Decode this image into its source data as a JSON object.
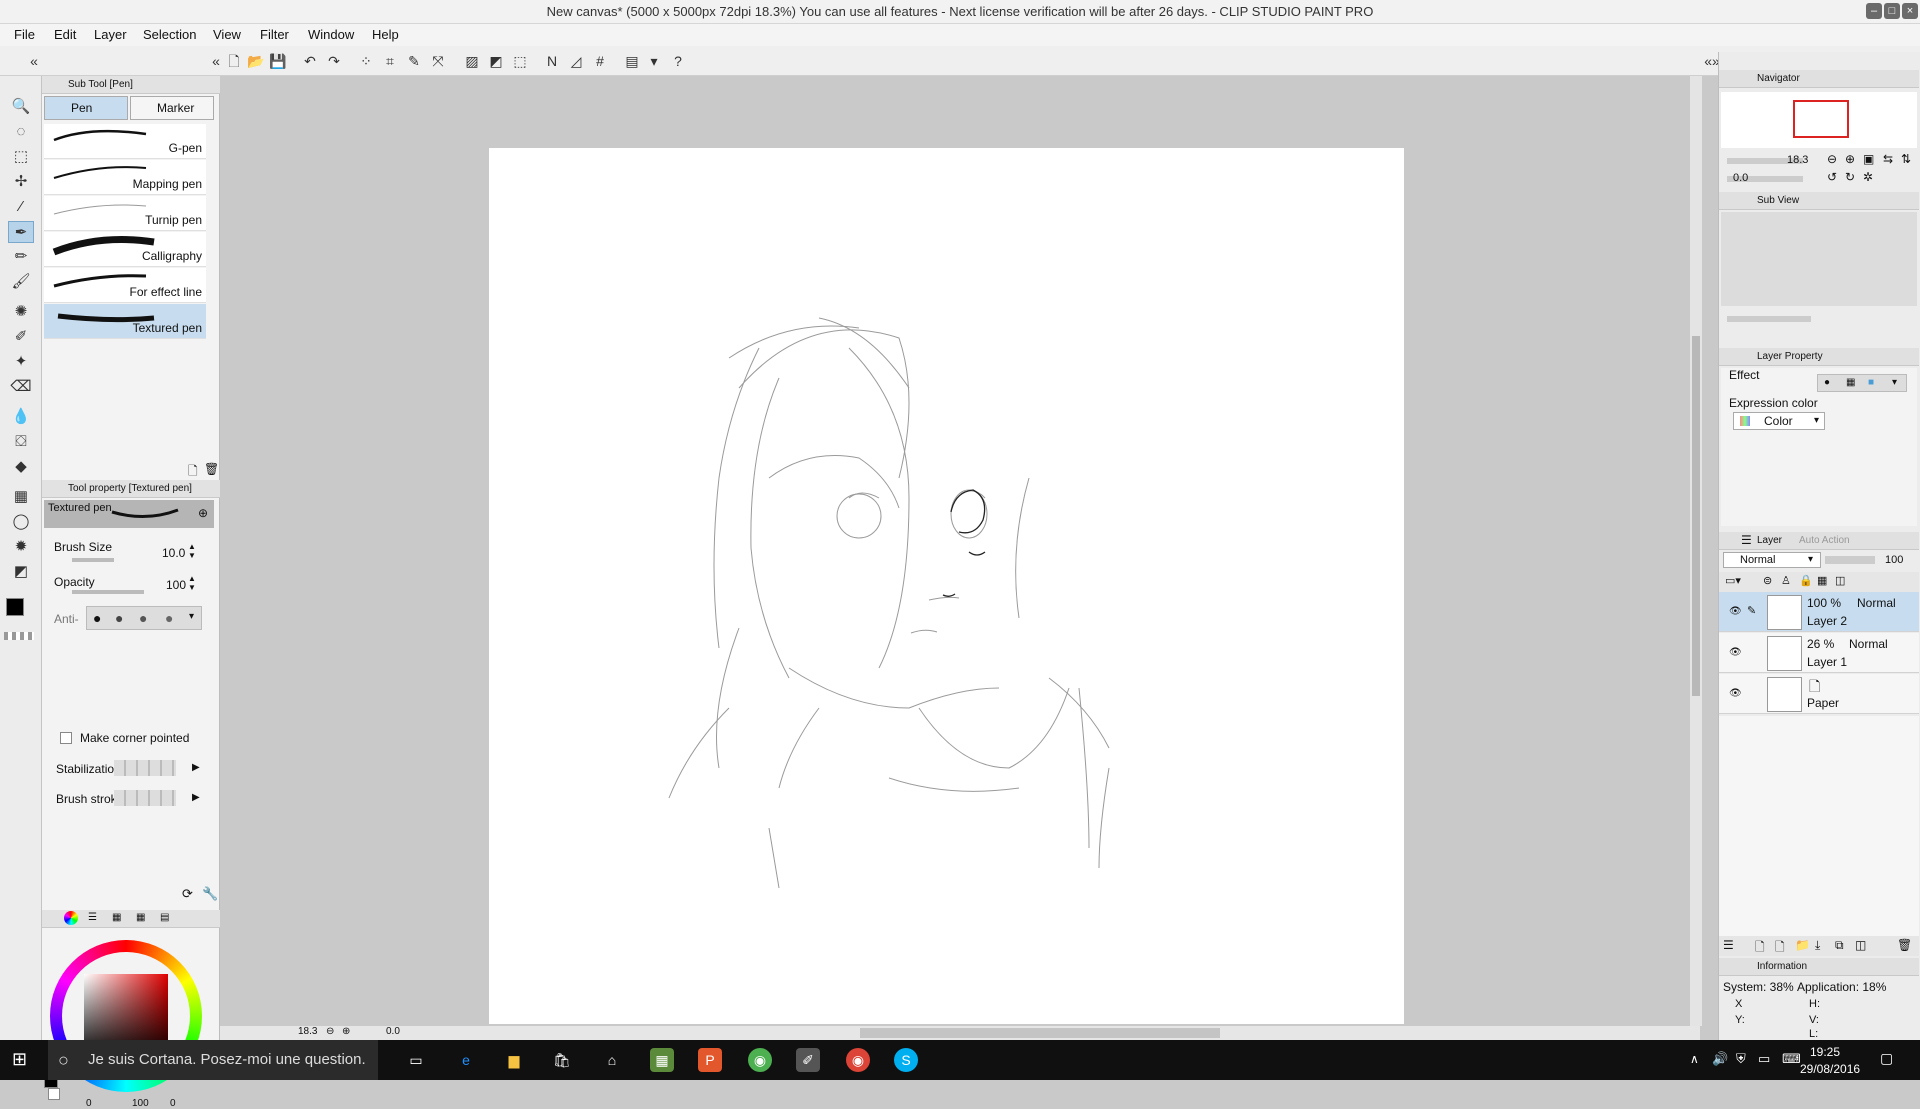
{
  "window": {
    "title": "New canvas* (5000 x 5000px 72dpi 18.3%)  You can use all features - Next license verification will be after 26 days. - CLIP STUDIO PAINT PRO"
  },
  "menu": [
    "File",
    "Edit",
    "Layer",
    "Selection",
    "View",
    "Filter",
    "Window",
    "Help"
  ],
  "sub_tool": {
    "panel_title": "Sub Tool [Pen]",
    "tabs": [
      "Pen",
      "Marker"
    ],
    "brushes": [
      "G-pen",
      "Mapping pen",
      "Turnip pen",
      "Calligraphy",
      "For effect line",
      "Textured pen"
    ],
    "selected_index": 5
  },
  "tool_property": {
    "panel_title": "Tool property [Textured pen]",
    "preview_name": "Textured pen",
    "brush_size_label": "Brush Size",
    "brush_size_value": "10.0",
    "opacity_label": "Opacity",
    "opacity_value": "100",
    "anti_label": "Anti-",
    "corner_label": "Make corner pointed",
    "stabilization_label": "Stabilization",
    "brush_stroke_label": "Brush stroke"
  },
  "color_panel": {
    "hue_value": "0",
    "sat_value": "0",
    "val_value": "100",
    "alpha_value": "0",
    "current_color": "#000000"
  },
  "navigator": {
    "panel_title": "Navigator",
    "zoom": "18.3",
    "rotation": "0.0"
  },
  "sub_view": {
    "panel_title": "Sub View"
  },
  "layer_property": {
    "panel_title": "Layer Property",
    "effect_label": "Effect",
    "expression_label": "Expression color",
    "expression_value": "Color"
  },
  "layer_panel": {
    "tab_layer": "Layer",
    "tab_auto": "Auto Action",
    "blend_mode": "Normal",
    "opacity": "100",
    "layers": [
      {
        "opacity": "100 %",
        "mode": "Normal",
        "name": "Layer 2",
        "selected": true
      },
      {
        "opacity": "26 %",
        "mode": "Normal",
        "name": "Layer 1",
        "selected": false
      },
      {
        "opacity": "",
        "mode": "",
        "name": "Paper",
        "selected": false
      }
    ]
  },
  "information": {
    "panel_title": "Information",
    "system": "System: 38%",
    "application": "Application: 18%",
    "x_label": "X",
    "y_label": "Y:",
    "h_label": "H:",
    "v_label": "V:",
    "l_label": "L:"
  },
  "status": {
    "zoom": "18.3",
    "rotation": "0.0"
  },
  "taskbar": {
    "cortana_placeholder": "Je suis Cortana. Posez-moi une question.",
    "time": "19:25",
    "date": "29/08/2016"
  },
  "colors": {
    "selection": "#c7ddef",
    "accent": "#7aa7cc",
    "taskbar": "#101010"
  }
}
